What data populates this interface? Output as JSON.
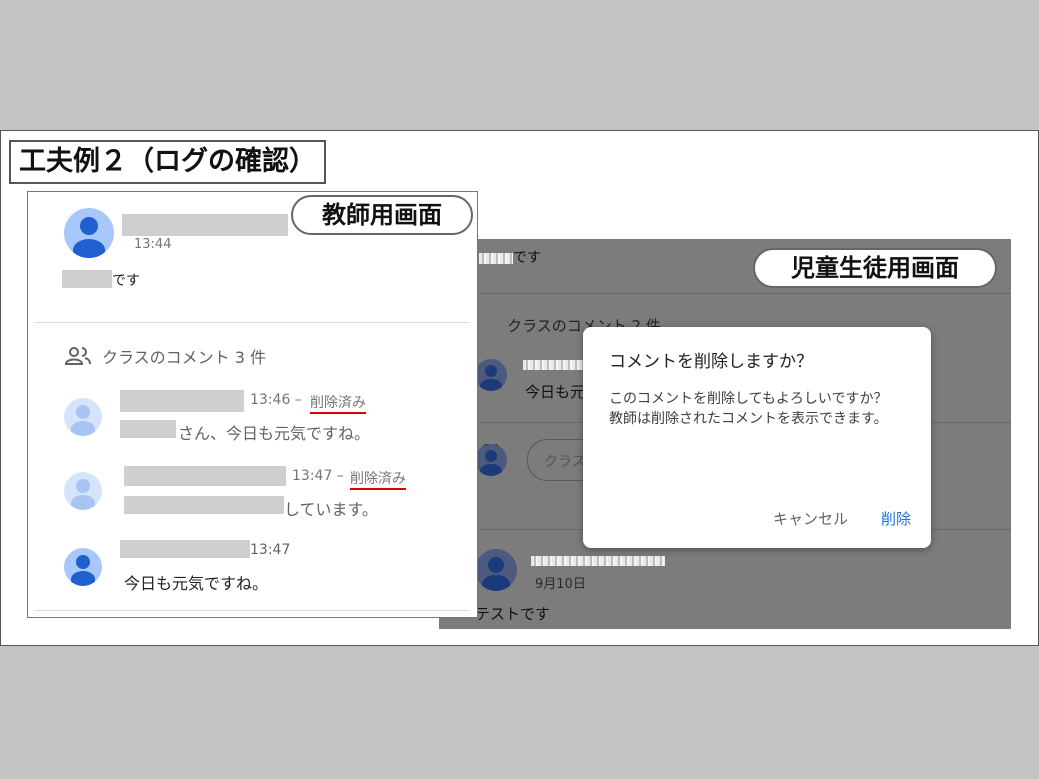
{
  "slide": {
    "title": "工夫例２（ログの確認）"
  },
  "teacher_view": {
    "label": "教師用画面",
    "post": {
      "time": "13:44",
      "text_suffix": "です"
    },
    "comments_header": "クラスのコメント 3 件",
    "comments": [
      {
        "time": "13:46 –",
        "status": "削除済み",
        "text_suffix": "さん、今日も元気ですね。"
      },
      {
        "time": "13:47 –",
        "status": "削除済み",
        "text_suffix": "しています。"
      },
      {
        "time": "13:47",
        "text": "今日も元気ですね。"
      }
    ]
  },
  "student_view": {
    "label": "児童生徒用画面",
    "top_text_suffix": "です",
    "comments_header": "クラスのコメント 2 件",
    "comment_preview": "今日も元",
    "input_placeholder": "クラス",
    "next_post": {
      "date": "9月10日",
      "text": "テストです"
    }
  },
  "dialog": {
    "title": "コメントを削除しますか？",
    "body_line1": "このコメントを削除してもよろしいですか？",
    "body_line2": "教師は削除されたコメントを表示できます。",
    "cancel_label": "キャンセル",
    "delete_label": "削除"
  },
  "colors": {
    "accent": "#1a73e8",
    "deleted_underline": "#dd0000",
    "overlay": "#7c7c7c"
  }
}
